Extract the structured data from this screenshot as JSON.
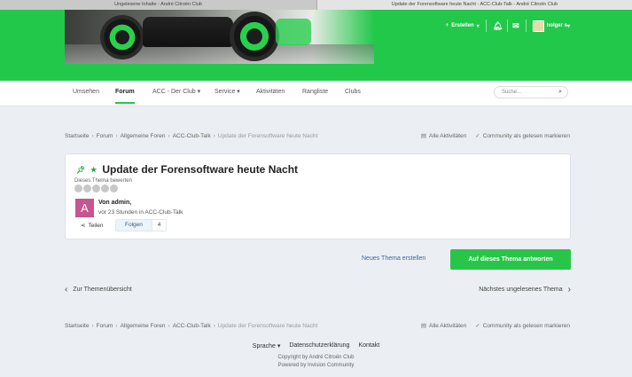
{
  "browser": {
    "tabs": [
      {
        "label": "Ungelesene Inhalte - André Citroën Club"
      },
      {
        "label": "Update der Forensoftware heute Nacht - ACC-Club-Talk - André Citroën Club"
      }
    ]
  },
  "header": {
    "create_label": "Erstellen",
    "username": "holger s"
  },
  "nav": {
    "items": [
      {
        "label": "Umsehen"
      },
      {
        "label": "Forum"
      },
      {
        "label": "ACC - Der Club"
      },
      {
        "label": "Service"
      },
      {
        "label": "Aktivitäten"
      },
      {
        "label": "Rangliste"
      },
      {
        "label": "Clubs"
      }
    ],
    "search_placeholder": "Suche..."
  },
  "breadcrumb": {
    "items": [
      "Startseite",
      "Forum",
      "Allgemeine Foren",
      "ACC-Club-Talk",
      "Update der Forensoftware heute Nacht"
    ],
    "all_activity": "Alle Aktivitäten",
    "mark_read": "Community als gelesen markieren"
  },
  "topic": {
    "title": "Update der Forensoftware heute Nacht",
    "rate_label": "Dieses Thema bewerten",
    "rating": 0,
    "rating_max": 5,
    "author_initial": "A",
    "author_line": "Von admin,",
    "time_line": "vor 23 Stunden in ACC-Club-Talk",
    "share_label": "Teilen",
    "follow_label": "Folgen",
    "follow_count": "4"
  },
  "actions": {
    "new_topic": "Neues Thema erstellen",
    "reply": "Auf dieses Thema antworten",
    "prev": "Zur Themenübersicht",
    "next": "Nächstes ungelesenes Thema"
  },
  "footer": {
    "links": [
      "Sprache",
      "Datenschutzerklärung",
      "Kontakt"
    ],
    "copyright": "Copyright by André Citroën Club",
    "powered": "Powered by Invision Community"
  },
  "colors": {
    "brand_green": "#22c84a",
    "reply_button": "#29c54b",
    "link_blue": "#3a6aa0",
    "avatar_pink": "#c7558e"
  }
}
